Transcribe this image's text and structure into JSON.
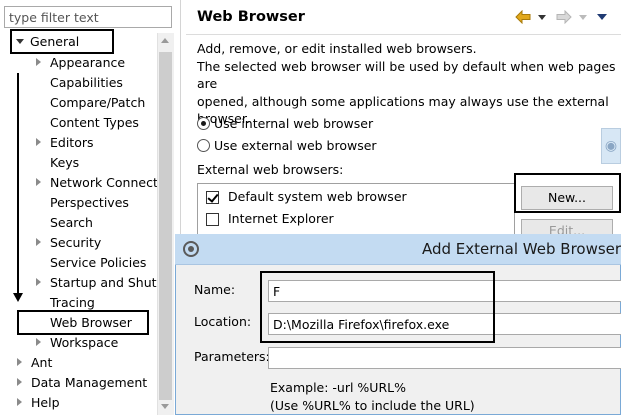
{
  "filter": {
    "placeholder": "type filter text"
  },
  "tree": {
    "general": "General",
    "items": {
      "appearance": "Appearance",
      "capabilities": "Capabilities",
      "compare_patch": "Compare/Patch",
      "content_types": "Content Types",
      "editors": "Editors",
      "keys": "Keys",
      "network_connections": "Network Connectio",
      "perspectives": "Perspectives",
      "search": "Search",
      "security": "Security",
      "service_policies": "Service Policies",
      "startup_shutdown": "Startup and Shutd",
      "tracing": "Tracing",
      "web_browser": "Web Browser",
      "workspace": "Workspace"
    },
    "ant": "Ant",
    "data_management": "Data Management",
    "help": "Help"
  },
  "page": {
    "title": "Web Browser",
    "description_line1": "Add, remove, or edit installed web browsers.",
    "description_line2": "The selected web browser will be used by default when web pages are",
    "description_line3": "opened, although some applications may always use the external",
    "description_line4": "browser.",
    "radio_internal": "Use internal web browser",
    "radio_external": "Use external web browser",
    "external_label": "External web browsers:",
    "browsers": [
      "Default system web browser",
      "Internet Explorer"
    ],
    "new_button": "New...",
    "edit_button": "Edit..."
  },
  "dialog": {
    "title": "Add External Web Browser",
    "name_label": "Name:",
    "name_value": "F",
    "location_label": "Location:",
    "location_value": "D:\\Mozilla Firefox\\firefox.exe",
    "parameters_label": "Parameters:",
    "parameters_value": "",
    "example_line1": "Example: -url %URL%",
    "example_line2": "(Use %URL% to include the URL)"
  },
  "colors": {
    "dialog_title_bg": "#c3dbf2",
    "nav_back_arrow": "#e2a81a",
    "annotation": "#000000"
  }
}
